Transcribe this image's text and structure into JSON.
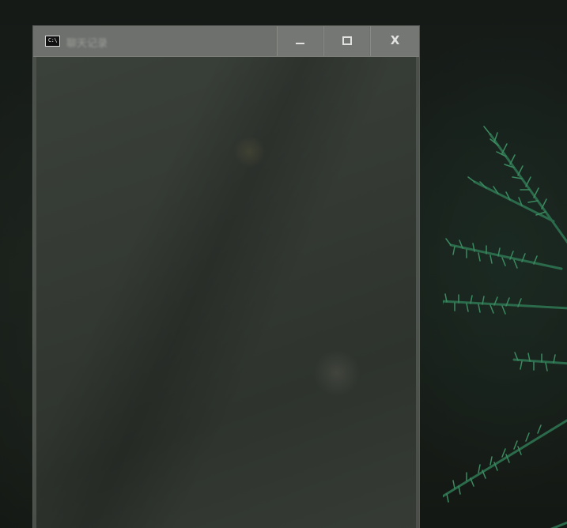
{
  "window": {
    "title": "聊天记录",
    "icon_text": "C:\\",
    "buttons": {
      "minimize": "minimize",
      "maximize": "maximize",
      "close": "X"
    }
  },
  "icons": [
    "console-app-icon",
    "minimize-icon",
    "maximize-icon",
    "close-icon"
  ],
  "colors": {
    "titlebar": "#6e706d",
    "window_body": "#343933",
    "desktop": "#151a17",
    "foliage": "#1f4a35"
  }
}
